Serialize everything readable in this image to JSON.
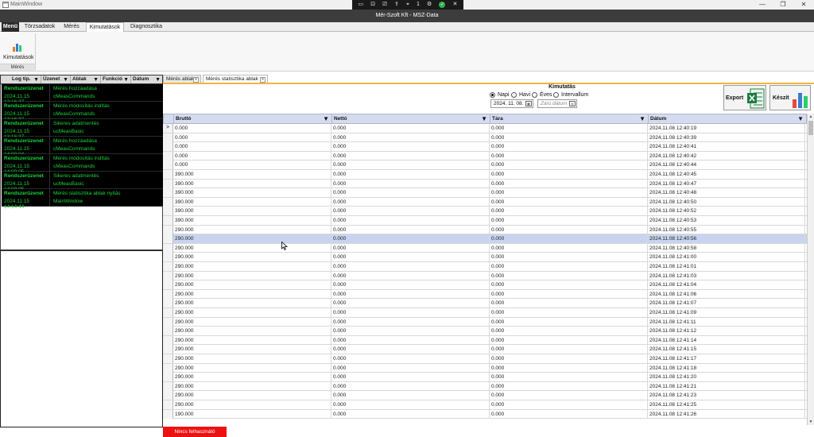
{
  "window": {
    "title": "MainWindow",
    "controls": {
      "minimize": "—",
      "maximize": "❐",
      "close": "✕"
    }
  },
  "remote_toolbar": {
    "display_label": "1"
  },
  "app": {
    "title": "Mér-Szoft Kft - MSZ-Data"
  },
  "menu_tabs": [
    {
      "label": "Menü"
    },
    {
      "label": "Törzsadatok"
    },
    {
      "label": "Mérés"
    },
    {
      "label": "Kimutatások"
    },
    {
      "label": "Diagnosztika"
    }
  ],
  "ribbon": {
    "button_label": "Kimutatások",
    "group_label": "Mérés"
  },
  "log_panel": {
    "columns": [
      "Log típ.",
      "Üzenet",
      "Ablak",
      "Funkció",
      "Dátum"
    ],
    "rows": [
      {
        "type": "Rendszerüzenet",
        "date": "2024.11.15 13:16:37",
        "message": "Mérés hozzáadása",
        "window": "cMeasCommands"
      },
      {
        "type": "Rendszerüzenet",
        "date": "2024.11.15 13:16:37",
        "message": "Mérés módosítás indítás",
        "window": "cMeasCommands"
      },
      {
        "type": "Rendszerüzenet",
        "date": "2024.11.15 13:16:37",
        "message": "Sikeres adatmentés",
        "window": "ucMeasBasic"
      },
      {
        "type": "Rendszerüzenet",
        "date": "2024.11.15 14:00:04",
        "message": "Mérés hozzáadása",
        "window": "cMeasCommands"
      },
      {
        "type": "Rendszerüzenet",
        "date": "2024.11.15 14:00:05",
        "message": "Mérés módosítás indítás",
        "window": "cMeasCommands"
      },
      {
        "type": "Rendszerüzenet",
        "date": "2024.11.15 14:00:05",
        "message": "Sikeres adatmentés",
        "window": "ucMeasBasic"
      },
      {
        "type": "Rendszerüzenet",
        "date": "2024.11.15 14:14:44",
        "message": "Mérés statisztika ablak nyitás",
        "window": "MainWindow"
      }
    ]
  },
  "doc_tabs": [
    {
      "label": "Mérés ablak",
      "close": "x"
    },
    {
      "label": "Mérés statisztika ablak",
      "close": "x"
    }
  ],
  "report": {
    "title": "Kimutatás",
    "options": [
      "Napi",
      "Havi",
      "Éves",
      "Intervallum"
    ],
    "selected": "Napi",
    "start_date": "2024. 11. 08.",
    "end_date_placeholder": "Zárú dátum",
    "export_label": "Export",
    "create_label": "Készít"
  },
  "grid": {
    "columns": [
      "Bruttó",
      "Nettó",
      "Tára",
      "Dátum"
    ],
    "current_row_marker": ">",
    "selected_row": 12,
    "rows": [
      [
        "0.000",
        "0.000",
        "0.000",
        "2024.11.08 12:40:19"
      ],
      [
        "0.000",
        "0.000",
        "0.000",
        "2024.11.08 12:40:39"
      ],
      [
        "0.000",
        "0.000",
        "0.000",
        "2024.11.08 12:40:41"
      ],
      [
        "0.000",
        "0.000",
        "0.000",
        "2024.11.08 12:40:42"
      ],
      [
        "0.000",
        "0.000",
        "0.000",
        "2024.11.08 12:40:44"
      ],
      [
        "390.000",
        "0.000",
        "0.000",
        "2024.11.08 12:40:45"
      ],
      [
        "390.000",
        "0.000",
        "0.000",
        "2024.11.08 12:40:47"
      ],
      [
        "390.000",
        "0.000",
        "0.000",
        "2024.11.08 12:40:48"
      ],
      [
        "390.000",
        "0.000",
        "0.000",
        "2024.11.08 12:40:50"
      ],
      [
        "390.000",
        "0.000",
        "0.000",
        "2024.11.08 12:40:52"
      ],
      [
        "390.000",
        "0.000",
        "0.000",
        "2024.11.08 12:40:53"
      ],
      [
        "290.000",
        "0.000",
        "0.000",
        "2024.11.08 12:40:55"
      ],
      [
        "290.000",
        "0.000",
        "0.000",
        "2024.11.08 12:40:56"
      ],
      [
        "290.000",
        "0.000",
        "0.000",
        "2024.11.08 12:40:58"
      ],
      [
        "290.000",
        "0.000",
        "0.000",
        "2024.11.08 12:41:00"
      ],
      [
        "290.000",
        "0.000",
        "0.000",
        "2024.11.08 12:41:01"
      ],
      [
        "290.000",
        "0.000",
        "0.000",
        "2024.11.08 12:41:03"
      ],
      [
        "290.000",
        "0.000",
        "0.000",
        "2024.11.08 12:41:04"
      ],
      [
        "290.000",
        "0.000",
        "0.000",
        "2024.11.08 12:41:06"
      ],
      [
        "290.000",
        "0.000",
        "0.000",
        "2024.11.08 12:41:07"
      ],
      [
        "290.000",
        "0.000",
        "0.000",
        "2024.11.08 12:41:09"
      ],
      [
        "290.000",
        "0.000",
        "0.000",
        "2024.11.08 12:41:11"
      ],
      [
        "290.000",
        "0.000",
        "0.000",
        "2024.11.08 12:41:12"
      ],
      [
        "290.000",
        "0.000",
        "0.000",
        "2024.11.08 12:41:14"
      ],
      [
        "290.000",
        "0.000",
        "0.000",
        "2024.11.08 12:41:15"
      ],
      [
        "290.000",
        "0.000",
        "0.000",
        "2024.11.08 12:41:17"
      ],
      [
        "290.000",
        "0.000",
        "0.000",
        "2024.11.08 12:41:18"
      ],
      [
        "290.000",
        "0.000",
        "0.000",
        "2024.11.08 12:41:20"
      ],
      [
        "290.000",
        "0.000",
        "0.000",
        "2024.11.08 12:41:21"
      ],
      [
        "290.000",
        "0.000",
        "0.000",
        "2024.11.08 12:41:23"
      ],
      [
        "290.000",
        "0.000",
        "0.000",
        "2024.11.08 12:41:25"
      ],
      [
        "190.000",
        "0.000",
        "0.000",
        "2024.11.08 12:41:26"
      ]
    ],
    "scroll": {
      "up": "▲",
      "down": "▼"
    }
  },
  "status": {
    "user_label": "Nincs felhasználó"
  },
  "colors": {
    "log_text": "#19d43a",
    "log_bg": "#000000",
    "status_bg": "#ee1111",
    "selected_row": "#c7d4ef",
    "tab_accent": "#f2b540"
  }
}
